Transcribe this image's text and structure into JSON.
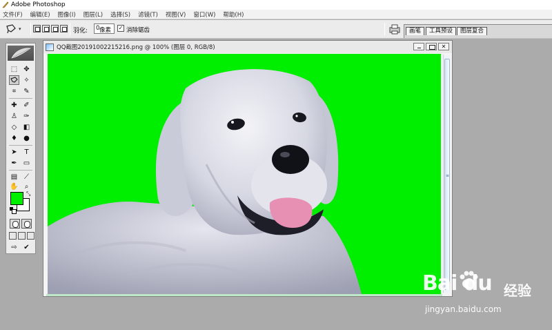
{
  "app": {
    "title": "Adobe Photoshop"
  },
  "menu": [
    "文件(F)",
    "编辑(E)",
    "图像(I)",
    "图层(L)",
    "选择(S)",
    "滤镜(T)",
    "视图(V)",
    "窗口(W)",
    "帮助(H)"
  ],
  "options": {
    "feather_label": "羽化:",
    "feather_value": "0",
    "feather_unit": "像素",
    "antialias_label": "消除锯齿",
    "antialias_checked": "✓"
  },
  "palette_well": {
    "tabs": [
      "画笔",
      "工具预设",
      "图层复合"
    ]
  },
  "toolbox": {
    "active_tool": "polygonal-lasso-tool",
    "foreground_color": "#00ee00",
    "background_color": "#ffffff"
  },
  "document": {
    "title": "QQ截图20191002215216.png @ 100% (图层 0, RGB/8)",
    "close_glyph": "✕",
    "background_color": "#00ee00",
    "content": "white dog photo"
  },
  "watermark": {
    "logo": "Bai du",
    "brand": "经验",
    "url": "jingyan.baidu.com"
  }
}
